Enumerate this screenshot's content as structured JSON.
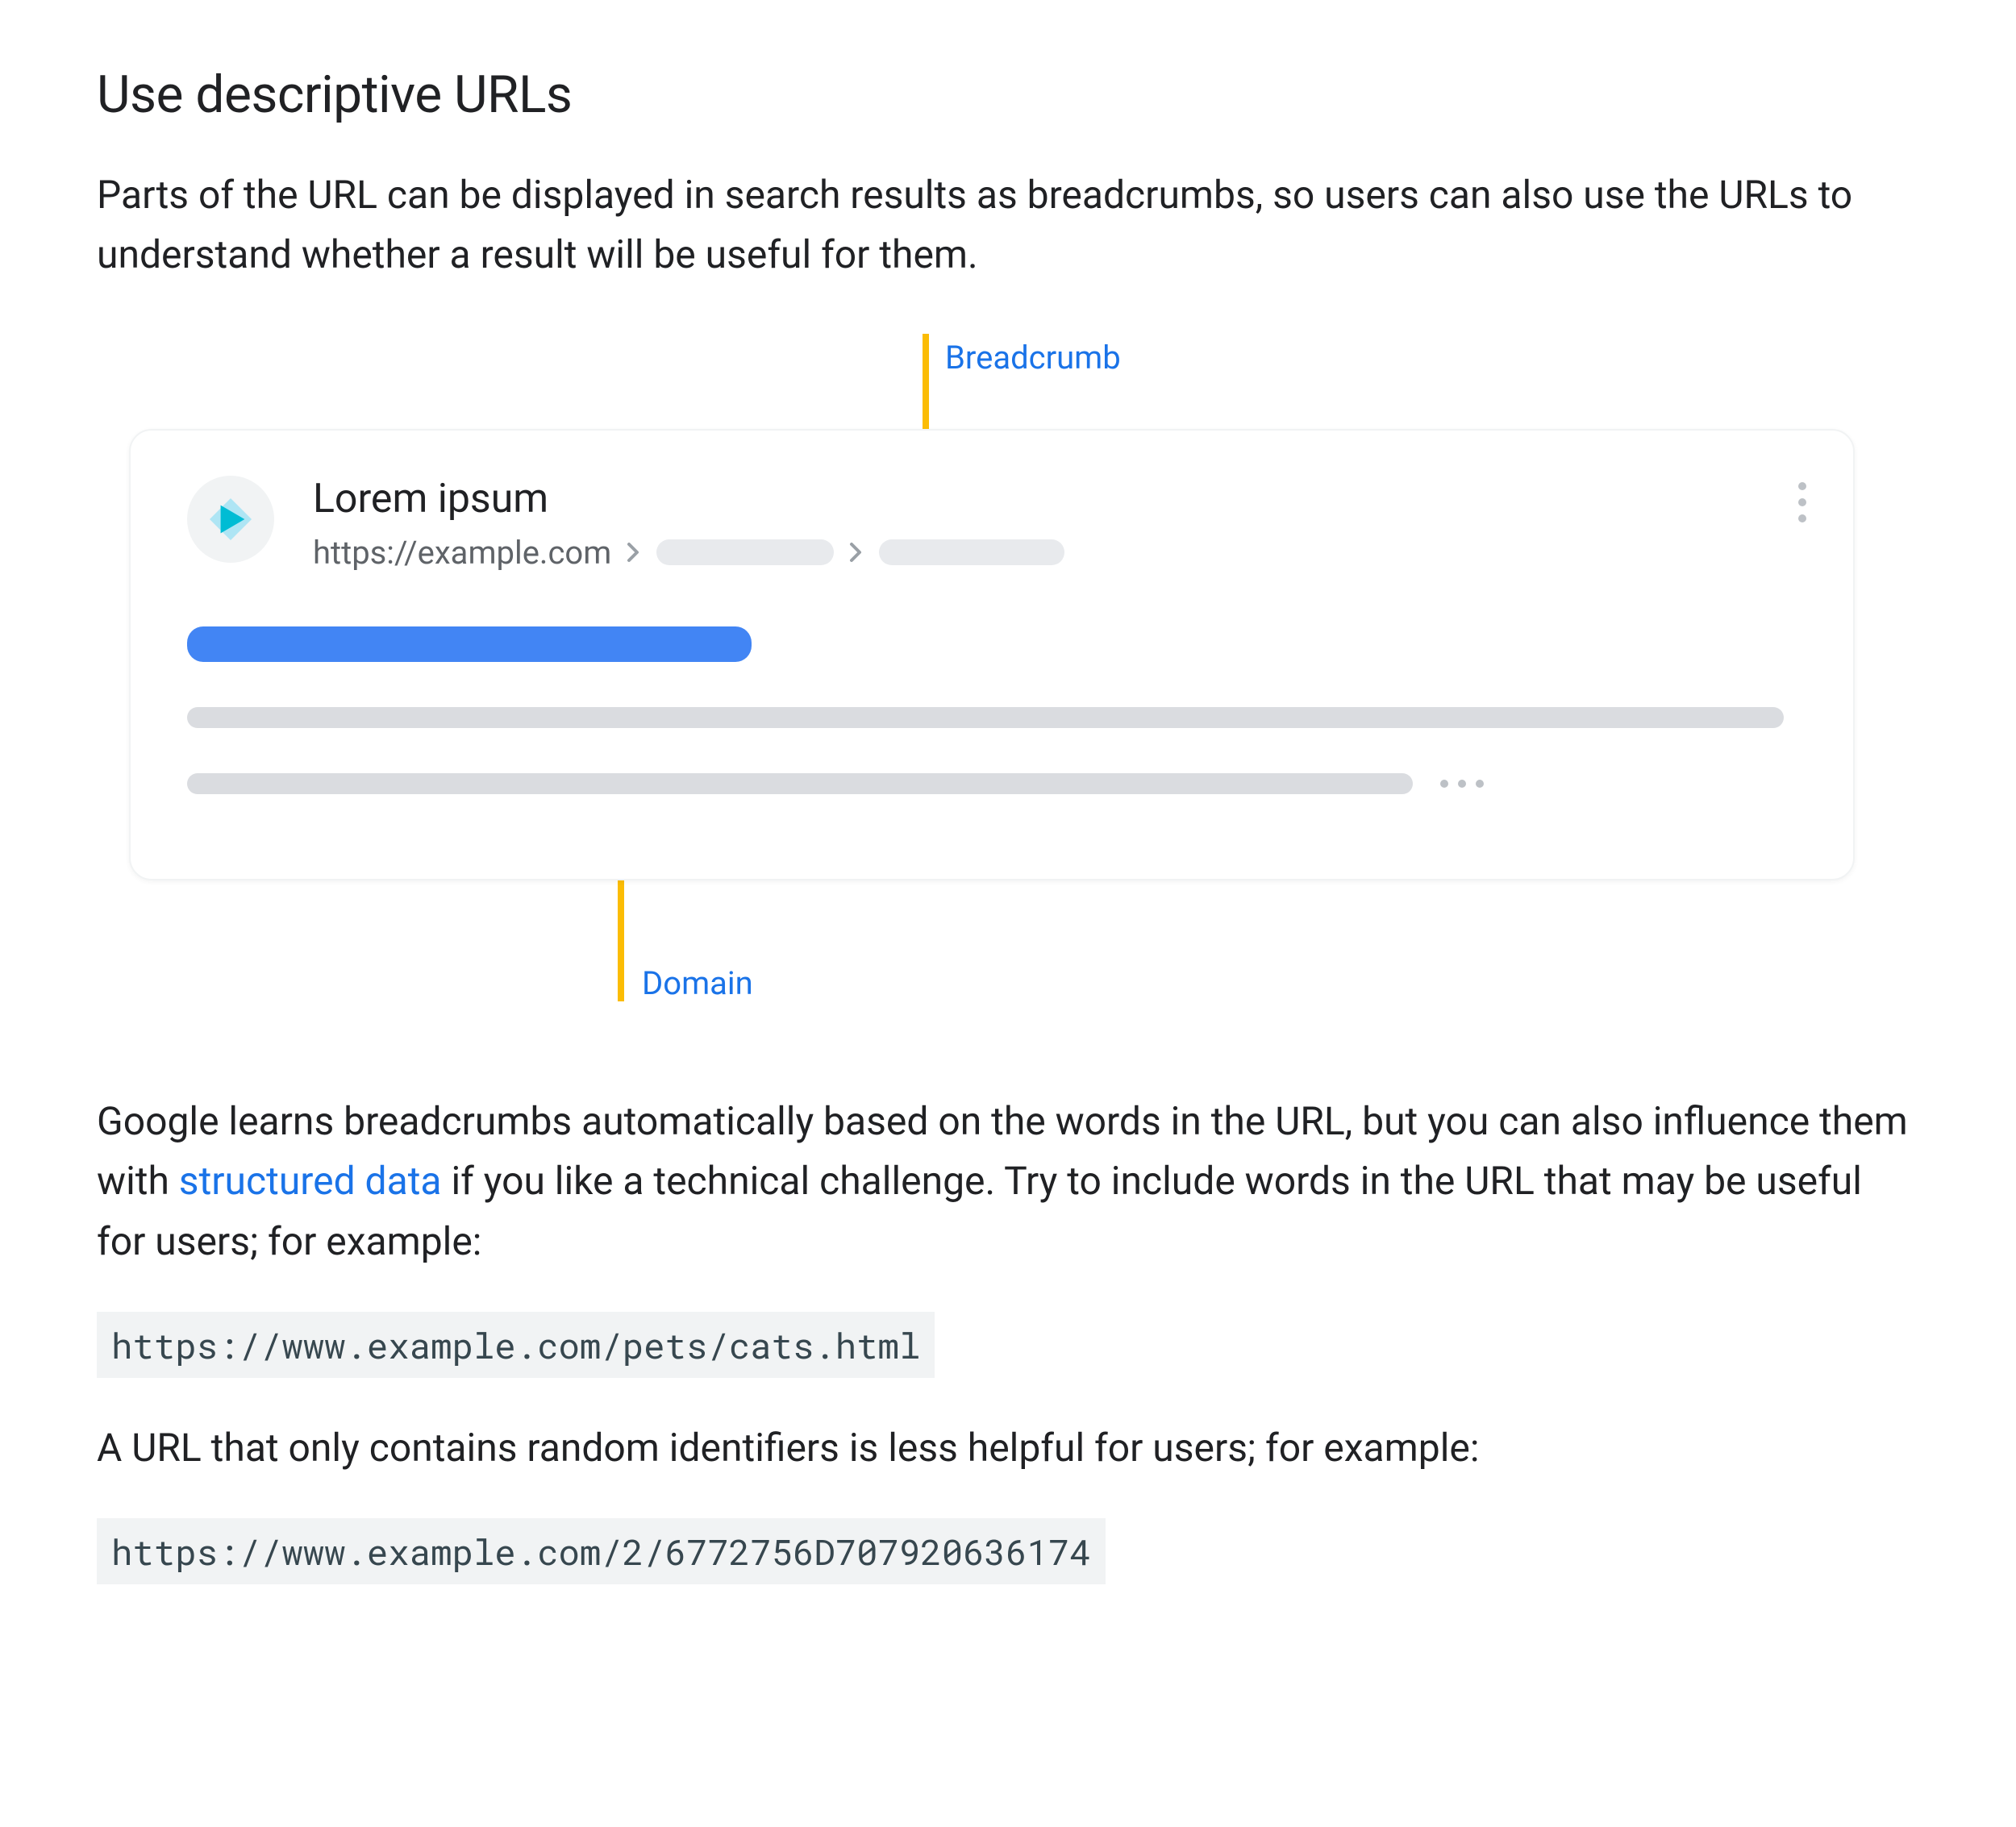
{
  "heading": "Use descriptive URLs",
  "intro": "Parts of the URL can be displayed in search results as breadcrumbs, so users can also use the URLs to understand whether a result will be useful for them.",
  "diagram": {
    "breadcrumb_label": "Breadcrumb",
    "domain_label": "Domain",
    "serp": {
      "site_name": "Lorem ipsum",
      "domain_text": "https://example.com"
    }
  },
  "para2_pre": "Google learns breadcrumbs automatically based on the words in the URL, but you can also influence them with ",
  "para2_link": "structured data",
  "para2_post": " if you like a technical challenge. Try to include words in the URL that may be useful for users; for example:",
  "code_good": "https://www.example.com/pets/cats.html",
  "para3": "A URL that only contains random identifiers is less helpful for users; for example:",
  "code_bad": "https://www.example.com/2/6772756D707920636174"
}
